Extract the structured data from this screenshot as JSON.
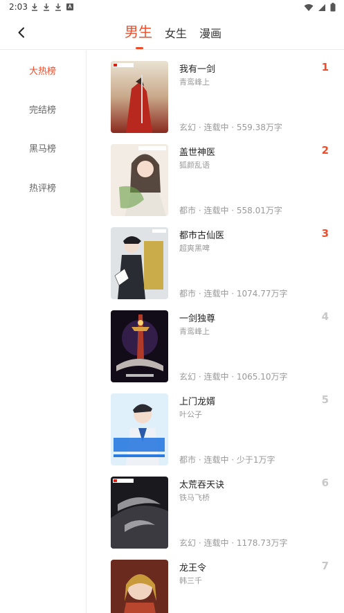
{
  "status_bar": {
    "time": "2:03"
  },
  "header": {
    "tabs": [
      {
        "label": "男生"
      },
      {
        "label": "女生"
      },
      {
        "label": "漫画"
      }
    ],
    "active_tab": "男生"
  },
  "sidebar": {
    "items": [
      {
        "label": "大热榜"
      },
      {
        "label": "完结榜"
      },
      {
        "label": "黑马榜"
      },
      {
        "label": "热评榜"
      }
    ],
    "active": "大热榜"
  },
  "books": [
    {
      "rank": "1",
      "title": "我有一剑",
      "author": "青鸾峰上",
      "meta": "玄幻 · 连载中 · 559.38万字"
    },
    {
      "rank": "2",
      "title": "盖世神医",
      "author": "狐颜乱语",
      "meta": "都市 · 连载中 · 558.01万字"
    },
    {
      "rank": "3",
      "title": "都市古仙医",
      "author": "超爽黑啤",
      "meta": "都市 · 连载中 · 1074.77万字"
    },
    {
      "rank": "4",
      "title": "一剑独尊",
      "author": "青鸾峰上",
      "meta": "玄幻 · 连载中 · 1065.10万字"
    },
    {
      "rank": "5",
      "title": "上门龙婿",
      "author": "叶公子",
      "meta": "都市 · 连载中 · 少于1万字"
    },
    {
      "rank": "6",
      "title": "太荒吞天诀",
      "author": "铁马飞桥",
      "meta": "玄幻 · 连载中 · 1178.73万字"
    },
    {
      "rank": "7",
      "title": "龙王令",
      "author": "韩三千",
      "meta": ""
    }
  ],
  "colors": {
    "accent": "#ef4d2a",
    "muted": "#999999",
    "rank_inactive": "#c8c8c8"
  }
}
